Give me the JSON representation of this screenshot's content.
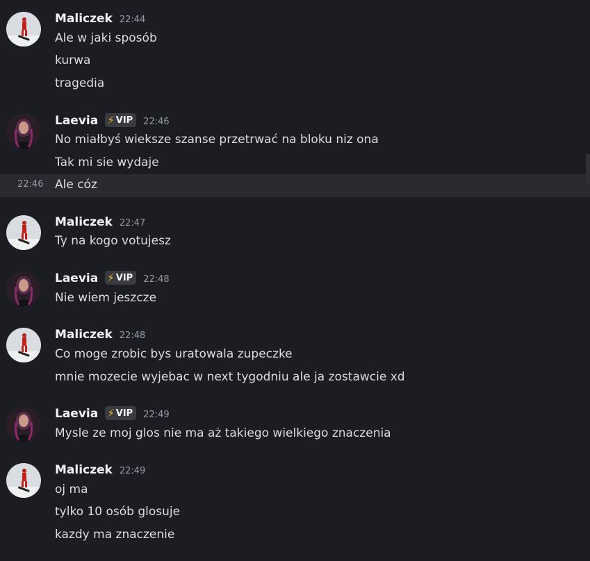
{
  "messages": [
    {
      "user": "Maliczek",
      "time": "22:44",
      "avatar": "snowboarder",
      "vip": false,
      "lines": [
        "Ale w jaki sposób",
        "kurwa",
        "tragedia"
      ]
    },
    {
      "user": "Laevia",
      "time": "22:46",
      "avatar": "woman",
      "vip": true,
      "lines": [
        "No miałbyś wieksze szanse przetrwać na bloku niz ona",
        "Tak mi sie wydaje"
      ]
    },
    {
      "hover_time": "22:46",
      "line": "Ale cóz"
    },
    {
      "user": "Maliczek",
      "time": "22:47",
      "avatar": "snowboarder",
      "vip": false,
      "lines": [
        "Ty na kogo votujesz"
      ]
    },
    {
      "user": "Laevia",
      "time": "22:48",
      "avatar": "woman",
      "vip": true,
      "lines": [
        "Nie wiem jeszcze"
      ]
    },
    {
      "user": "Maliczek",
      "time": "22:48",
      "avatar": "snowboarder",
      "vip": false,
      "lines": [
        "Co moge zrobic bys uratowala zupeczke",
        "mnie mozecie wyjebac w next tygodniu ale ja zostawcie xd"
      ]
    },
    {
      "user": "Laevia",
      "time": "22:49",
      "avatar": "woman",
      "vip": true,
      "lines": [
        "Mysle ze moj glos nie ma aż takiego wielkiego znaczenia"
      ]
    },
    {
      "user": "Maliczek",
      "time": "22:49",
      "avatar": "snowboarder",
      "vip": false,
      "lines": [
        "oj ma",
        "tylko 10 osób glosuje",
        "kazdy ma znaczenie"
      ]
    }
  ],
  "vip_tag": {
    "icon": "lightning-icon",
    "label": "VIP"
  },
  "colors": {
    "background": "#1c1d22",
    "hover": "#2a2b30",
    "vip_bolt": "#f0b232"
  }
}
